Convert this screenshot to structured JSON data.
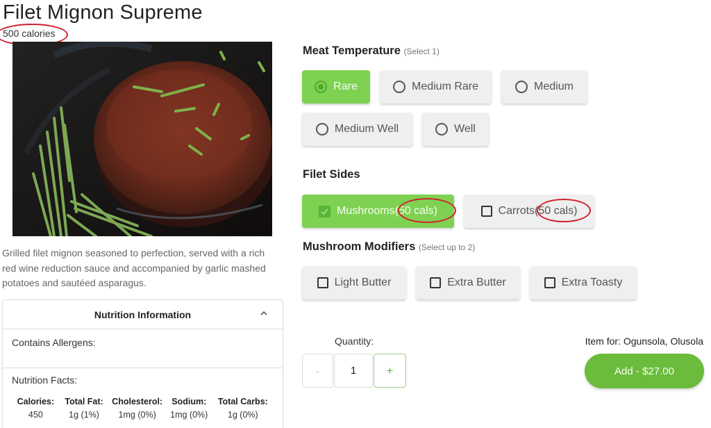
{
  "item": {
    "title": "Filet Mignon Supreme",
    "calories": "500 calories",
    "image_alt": "Seared filet mignon in a cast iron skillet with rosemary sprigs",
    "description": "Grilled filet mignon seasoned to perfection, served with a rich red wine reduction sauce and accompanied by garlic mashed potatoes and sautéed asparagus."
  },
  "nutrition": {
    "header": "Nutrition Information",
    "expanded": true,
    "allergens_label": "Contains Allergens:",
    "facts_label": "Nutrition Facts:",
    "facts": [
      {
        "label": "Calories:",
        "value": "450"
      },
      {
        "label": "Total Fat:",
        "value": "1g (1%)"
      },
      {
        "label": "Cholesterol:",
        "value": "1mg (0%)"
      },
      {
        "label": "Sodium:",
        "value": "1mg (0%)"
      },
      {
        "label": "Total Carbs:",
        "value": "1g (0%)"
      }
    ]
  },
  "meat_temperature": {
    "title": "Meat Temperature",
    "hint": "(Select 1)",
    "options": [
      {
        "label": "Rare",
        "selected": true
      },
      {
        "label": "Medium Rare",
        "selected": false
      },
      {
        "label": "Medium",
        "selected": false
      },
      {
        "label": "Medium Well",
        "selected": false
      },
      {
        "label": "Well",
        "selected": false
      }
    ]
  },
  "filet_sides": {
    "title": "Filet Sides",
    "options": [
      {
        "label": "Mushrooms",
        "cals": "(50 cals)",
        "selected": true
      },
      {
        "label": "Carrots",
        "cals": "(50 cals)",
        "selected": false
      }
    ]
  },
  "mushroom_modifiers": {
    "title": "Mushroom Modifiers",
    "hint": "(Select up to 2)",
    "options": [
      {
        "label": "Light Butter",
        "selected": false
      },
      {
        "label": "Extra Butter",
        "selected": false
      },
      {
        "label": "Extra Toasty",
        "selected": false
      }
    ]
  },
  "order": {
    "quantity_label": "Quantity:",
    "quantity": "1",
    "minus_label": "-",
    "plus_label": "+",
    "item_for": "Item for: Ogunsola, Olusola",
    "add_button": "Add - $27.00"
  },
  "colors": {
    "accent_green": "#7fd152",
    "button_green": "#6bbb3c",
    "annotation_red": "#d0202a"
  }
}
